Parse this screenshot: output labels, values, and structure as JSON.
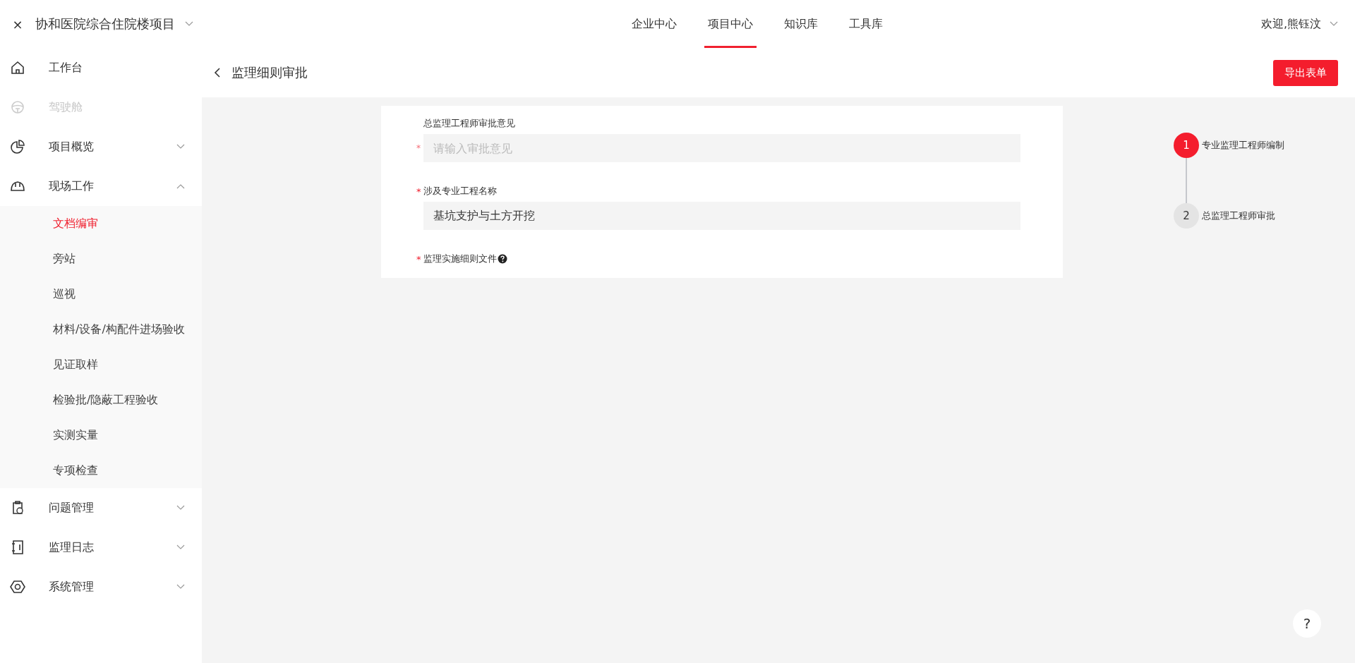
{
  "topbar": {
    "close": "×",
    "project": "协和医院综合住院楼项目",
    "nav": [
      {
        "label": "企业中心",
        "selected": false
      },
      {
        "label": "项目中心",
        "selected": true
      },
      {
        "label": "知识库",
        "selected": false
      },
      {
        "label": "工具库",
        "selected": false
      }
    ],
    "user": "欢迎,熊钰汶"
  },
  "sidebar": {
    "items": [
      {
        "label": "工作台",
        "disabled": false
      },
      {
        "label": "驾驶舱",
        "disabled": true
      },
      {
        "label": "项目概览",
        "disabled": false,
        "expanded": false
      },
      {
        "label": "现场工作",
        "disabled": false,
        "expanded": true,
        "children": [
          {
            "label": "文档编审",
            "selected": true
          },
          {
            "label": "旁站",
            "selected": false
          },
          {
            "label": "巡视",
            "selected": false
          },
          {
            "label": "材料/设备/构配件进场验收",
            "selected": false
          },
          {
            "label": "见证取样",
            "selected": false
          },
          {
            "label": "检验批/隐蔽工程验收",
            "selected": false
          },
          {
            "label": "实测实量",
            "selected": false
          },
          {
            "label": "专项检查",
            "selected": false
          }
        ]
      },
      {
        "label": "问题管理",
        "disabled": false,
        "expanded": false
      },
      {
        "label": "监理日志",
        "disabled": false,
        "expanded": false
      },
      {
        "label": "系统管理",
        "disabled": false,
        "expanded": false
      }
    ]
  },
  "page": {
    "title": "监理细则审批",
    "export_button": "导出表单"
  },
  "form": {
    "required_mark": "*",
    "fields": [
      {
        "kind": "input",
        "label": "总监理工程师审批意见",
        "required": true,
        "mark_beside_field": true,
        "placeholder": "请输入审批意见"
      },
      {
        "kind": "input",
        "label": "涉及专业工程名称",
        "required": true,
        "mark_beside_field": false,
        "value": "基坑支护与土方开挖"
      },
      {
        "kind": "file",
        "label": "监理实施细则文件",
        "required": true,
        "mark_beside_field": false
      }
    ]
  },
  "steps": [
    {
      "number": "1",
      "label": "专业监理工程师编制",
      "selected": true
    },
    {
      "number": "2",
      "label": "总监理工程师审批",
      "selected": false
    }
  ],
  "help_button": "?"
}
